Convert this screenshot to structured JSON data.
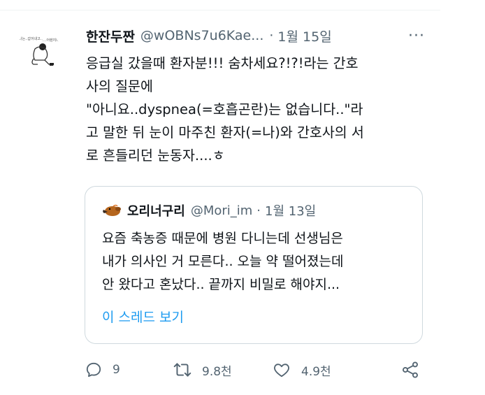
{
  "tweet": {
    "display_name": "한잔두짠",
    "handle": "@wOBNs7u6Kae...",
    "separator": "·",
    "date": "1월 15일",
    "more_label": "···",
    "text_lines": [
      "응급실 갔을때 환자분!!! 숨차세요?!?!라는 간호",
      "사의 질문에",
      "\"아니요..dyspnea(=호흡곤란)는 없습니다..\"라",
      "고 말한 뒤 눈이 마주친 환자(=나)와 간호사의 서",
      "로 흔들리던 눈동자....ㅎ"
    ],
    "avatar_text": [
      "나는..갑어내고..",
      "....어렌지너"
    ]
  },
  "quote": {
    "display_name": "오리너구리",
    "handle": "@Mori_im",
    "separator": "·",
    "date": "1월 13일",
    "text_lines": [
      "요즘 축농증 때문에 병원 다니는데 선생님은",
      "내가 의사인 거 모른다.. 오늘 약 떨어졌는데",
      "안 왔다고 혼났다.. 끝까지 비밀로 해야지..."
    ],
    "thread_link": "이 스레드 보기"
  },
  "actions": {
    "reply_count": "9",
    "retweet_count": "9.8천",
    "like_count": "4.9천"
  },
  "icons": {
    "reply": "comment-icon",
    "retweet": "retweet-icon",
    "like": "heart-icon",
    "share": "share-icon",
    "more": "more-dots-icon"
  },
  "colors": {
    "text": "#0f1419",
    "secondary": "#536471",
    "link": "#1d9bf0",
    "border": "#cfd9de"
  }
}
